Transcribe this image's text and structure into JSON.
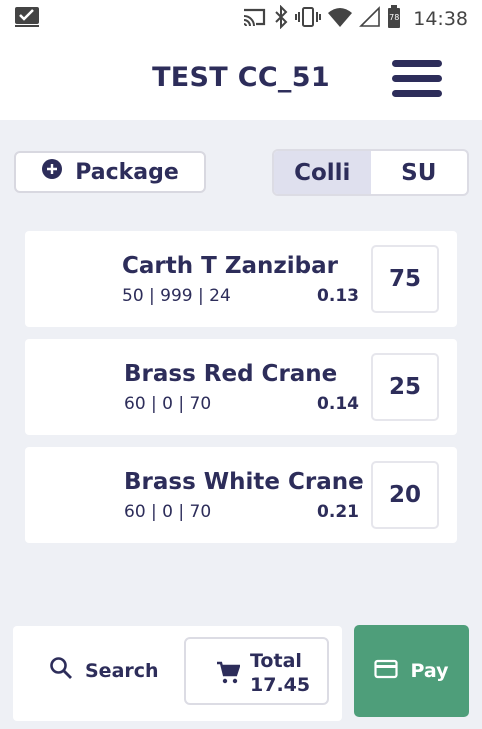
{
  "status_bar": {
    "time": "14:38",
    "battery": "78",
    "icons": [
      "notification-check-icon",
      "cast-icon",
      "bluetooth-icon",
      "vibrate-icon",
      "wifi-icon",
      "signal-icon",
      "battery-icon"
    ]
  },
  "header": {
    "title": "TEST CC_51",
    "menu_icon": "hamburger-menu-icon"
  },
  "toolbar": {
    "package_label": "Package",
    "segments": [
      {
        "label": "Colli",
        "active": true
      },
      {
        "label": "SU",
        "active": false
      }
    ]
  },
  "items": [
    {
      "name": "Carth T Zanzibar",
      "meta": "50  | 999  | 24",
      "price": "0.13",
      "qty": "75"
    },
    {
      "name": "Brass Red Crane",
      "meta": "60  | 0  | 70",
      "price": "0.14",
      "qty": "25"
    },
    {
      "name": "Brass White Crane",
      "meta": "60  | 0  | 70",
      "price": "0.21",
      "qty": "20"
    }
  ],
  "footer": {
    "search_label": "Search",
    "total_label": "Total",
    "total_value": "17.45",
    "pay_label": "Pay"
  },
  "colors": {
    "primary_text": "#2d2d5a",
    "background": "#eef0f5",
    "pay_button": "#4e9e7a",
    "segment_active": "#dfe0ee"
  }
}
